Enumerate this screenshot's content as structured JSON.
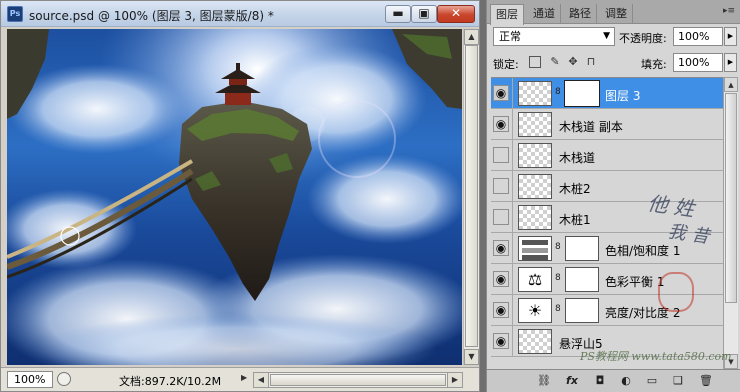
{
  "document": {
    "title": "source.psd @ 100% (图层 3, 图层蒙版/8) *",
    "app_icon": "Ps",
    "window_buttons": {
      "minimize": "▬",
      "maximize": "▣",
      "close": "✕"
    },
    "status": {
      "zoom": "100%",
      "doc_size": "文档:897.2K/10.2M",
      "arrow": "▶"
    }
  },
  "layers_panel": {
    "tabs": [
      "图层",
      "通道",
      "路径",
      "调整"
    ],
    "active_tab": 0,
    "menu_icon": "▸≡",
    "blend_mode": "正常",
    "opacity_label": "不透明度:",
    "opacity_value": "100%",
    "lock_label": "锁定:",
    "fill_label": "填充:",
    "fill_value": "100%",
    "layers": [
      {
        "name": "图层 3",
        "visible": true,
        "selected": true,
        "has_mask": true,
        "type": "pixel"
      },
      {
        "name": "木栈道 副本",
        "visible": true,
        "selected": false,
        "has_mask": false,
        "type": "pixel"
      },
      {
        "name": "木栈道",
        "visible": false,
        "selected": false,
        "has_mask": false,
        "type": "pixel"
      },
      {
        "name": "木桩2",
        "visible": false,
        "selected": false,
        "has_mask": false,
        "type": "pixel"
      },
      {
        "name": "木桩1",
        "visible": false,
        "selected": false,
        "has_mask": false,
        "type": "pixel"
      },
      {
        "name": "色相/饱和度 1",
        "visible": true,
        "selected": false,
        "has_mask": true,
        "type": "adjustment-hue"
      },
      {
        "name": "色彩平衡 1",
        "visible": true,
        "selected": false,
        "has_mask": true,
        "type": "adjustment-balance"
      },
      {
        "name": "亮度/对比度 2",
        "visible": true,
        "selected": false,
        "has_mask": true,
        "type": "adjustment-brightness"
      },
      {
        "name": "悬浮山5",
        "visible": true,
        "selected": false,
        "has_mask": false,
        "type": "pixel"
      }
    ],
    "bottom_icons": [
      "link-icon",
      "fx-icon",
      "mask-icon",
      "adjustment-icon",
      "group-icon",
      "new-layer-icon",
      "trash-icon"
    ]
  },
  "watermark": {
    "url": "PS教程网 www.tata580.com"
  },
  "colors": {
    "selection": "#3f8fe6",
    "title_gradient": "#c3d3e8",
    "close_button": "#c9452c"
  }
}
